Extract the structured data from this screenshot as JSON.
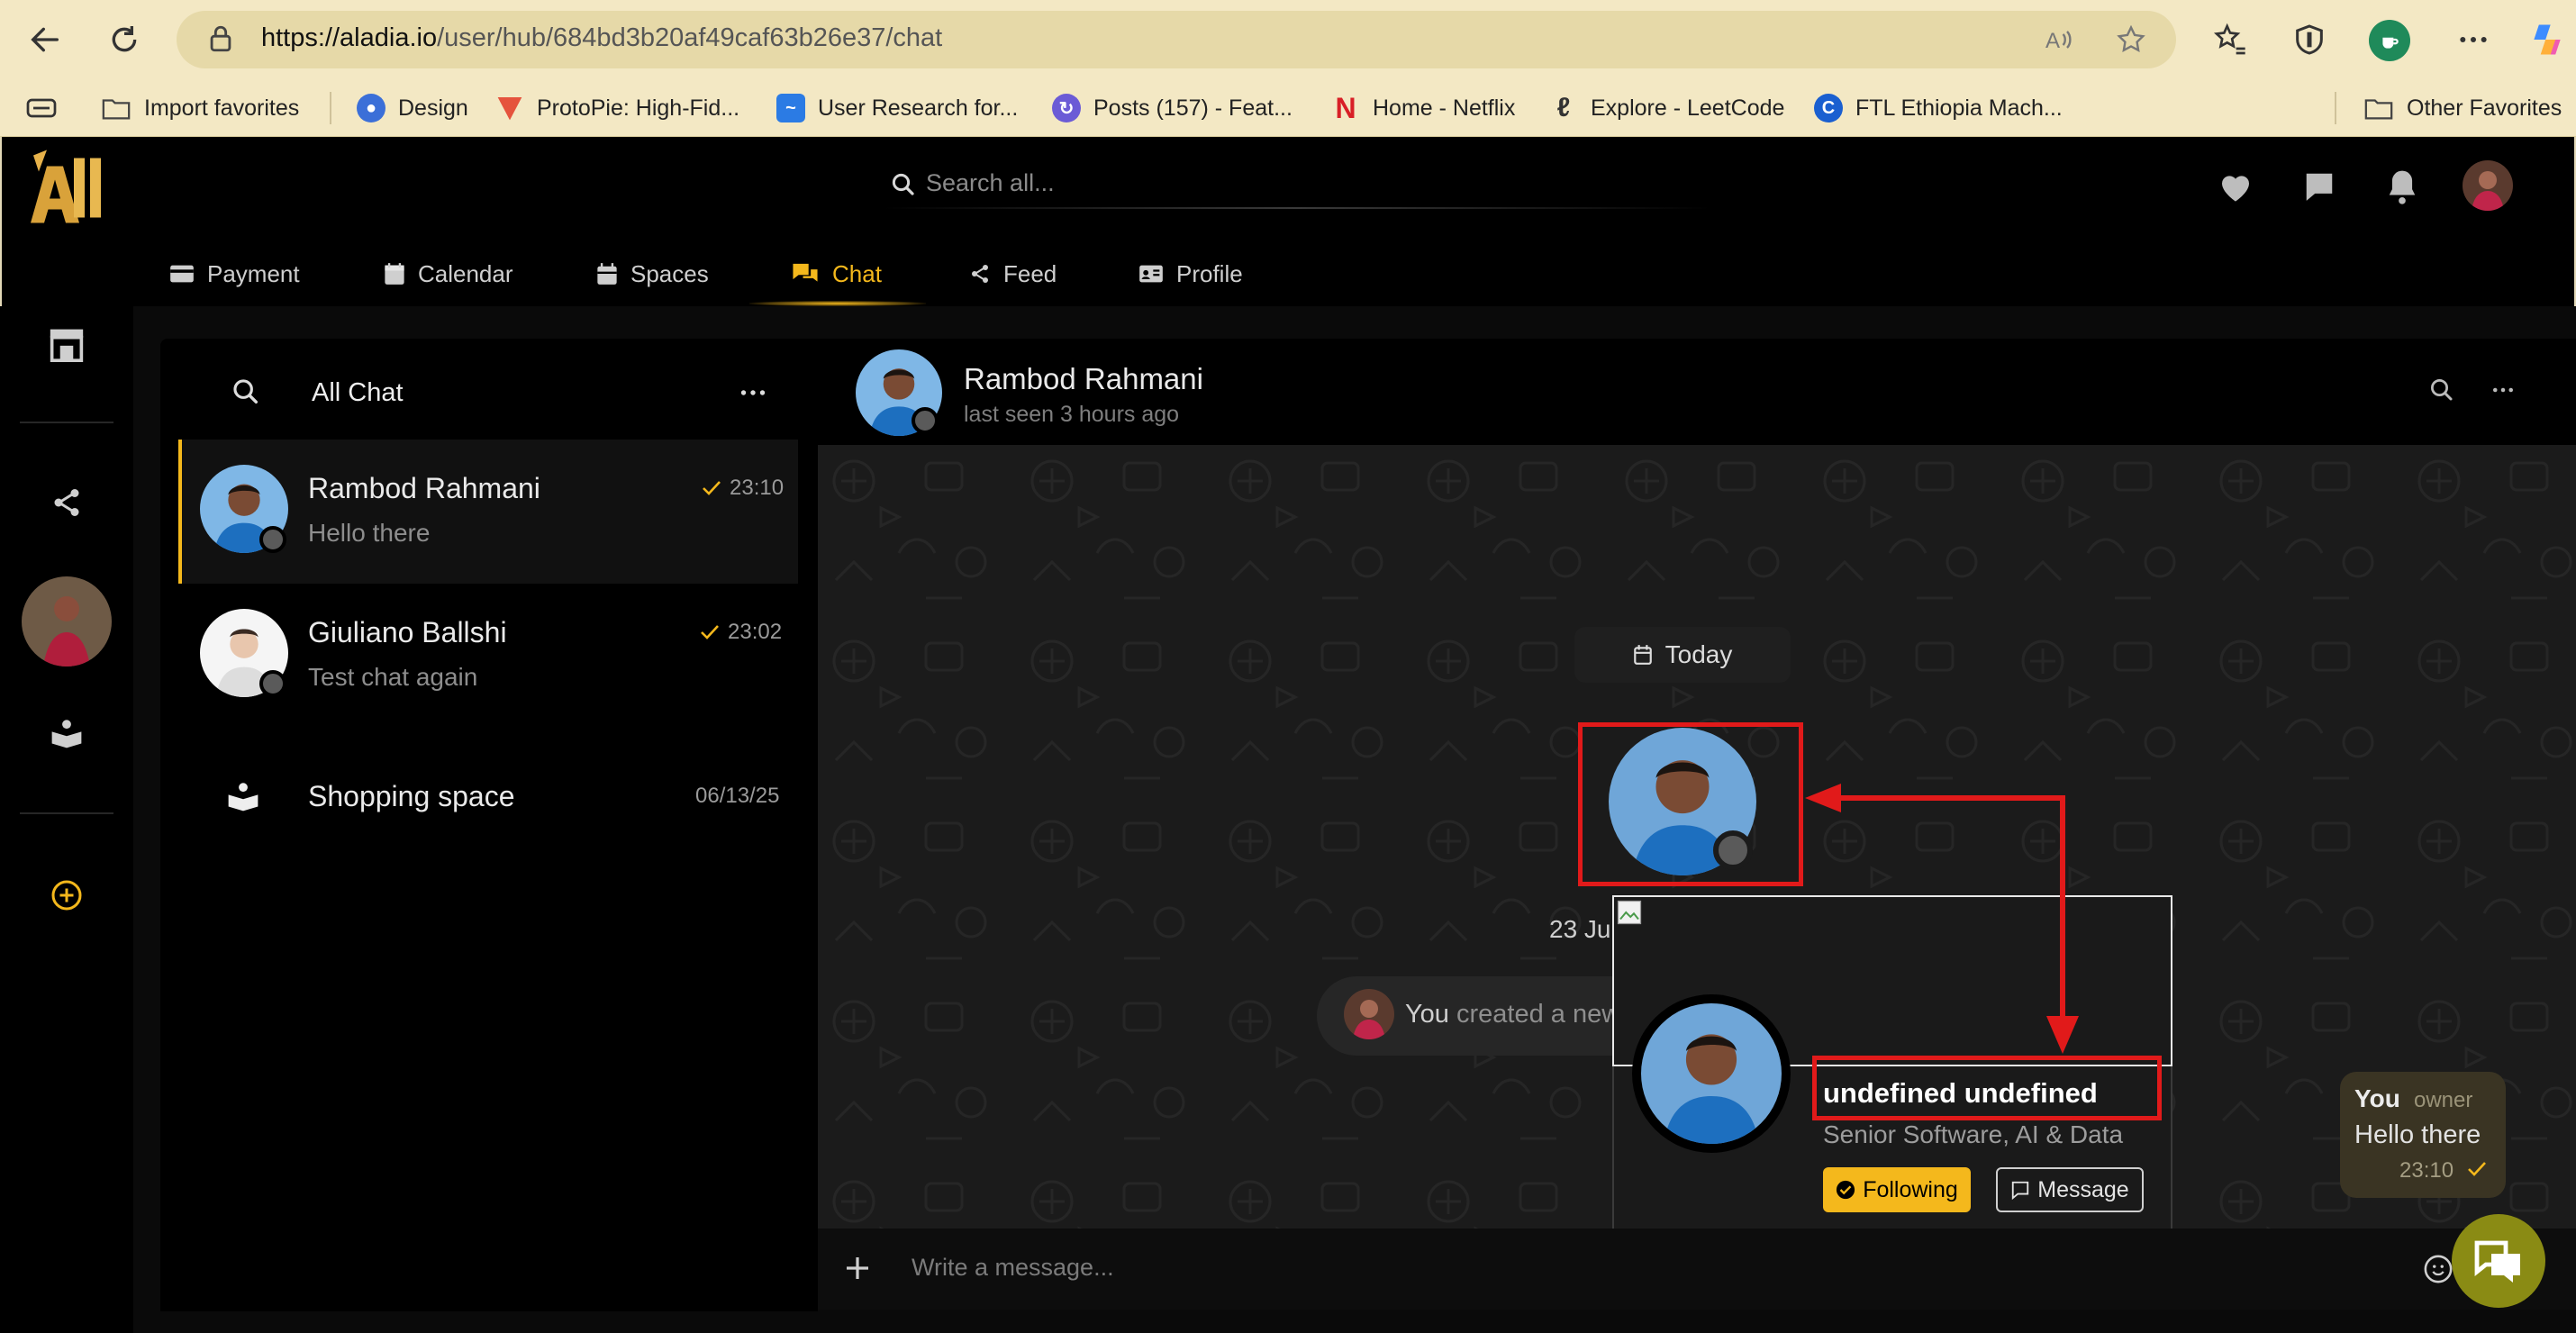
{
  "browser": {
    "url_host": "https://aladia.io",
    "url_path": "/user/hub/684bd3b20af49caf63b26e37/chat",
    "bookmarks": [
      {
        "label": "Import favorites",
        "color": "#555555",
        "icon": "folder-icon"
      },
      {
        "label": "Design",
        "color": "#3b6fd8",
        "icon": "palette-icon"
      },
      {
        "label": "ProtoPie: High-Fid...",
        "color": "#e5533d",
        "icon": "protopie-icon"
      },
      {
        "label": "User Research for...",
        "color": "#2b7be4",
        "icon": "research-icon"
      },
      {
        "label": "Posts (157) - Feat...",
        "color": "#6b5bd6",
        "icon": "posts-icon"
      },
      {
        "label": "Home - Netflix",
        "color": "#d81f26",
        "icon": "netflix-icon"
      },
      {
        "label": "Explore - LeetCode",
        "color": "#f0a020",
        "icon": "leetcode-icon"
      },
      {
        "label": "FTL Ethiopia Mach...",
        "color": "#1a5fd0",
        "icon": "ftl-icon"
      }
    ],
    "other_favorites": "Other Favorites"
  },
  "app": {
    "search_placeholder": "Search all...",
    "tabs": [
      {
        "label": "Payment",
        "icon": "credit-card-icon"
      },
      {
        "label": "Calendar",
        "icon": "calendar-icon"
      },
      {
        "label": "Spaces",
        "icon": "spaces-icon"
      },
      {
        "label": "Chat",
        "icon": "chat-icon",
        "active": true
      },
      {
        "label": "Feed",
        "icon": "share-icon"
      },
      {
        "label": "Profile",
        "icon": "id-card-icon"
      }
    ],
    "accent_color": "#f4b81c"
  },
  "chat_list": {
    "title": "All Chat",
    "items": [
      {
        "name": "Rambod Rahmani",
        "preview": "Hello there",
        "time": "23:10",
        "read": true,
        "active": true
      },
      {
        "name": "Giuliano Ballshi",
        "preview": "Test chat again",
        "time": "23:02",
        "read": true
      },
      {
        "name": "Shopping space",
        "preview": "",
        "time": "06/13/25"
      }
    ]
  },
  "conversation": {
    "name": "Rambod Rahmani",
    "status": "last seen 3 hours ago",
    "date_pill": "Today",
    "date_fragment": "23 Ju",
    "system_you": "You",
    "system_text": "created a new",
    "message": {
      "sender": "You",
      "role": "owner",
      "text": "Hello there",
      "time": "23:10"
    },
    "compose_placeholder": "Write a message..."
  },
  "popover": {
    "name": "undefined undefined",
    "subtitle": "Senior Software, AI & Data",
    "follow_label": "Following",
    "message_label": "Message"
  }
}
